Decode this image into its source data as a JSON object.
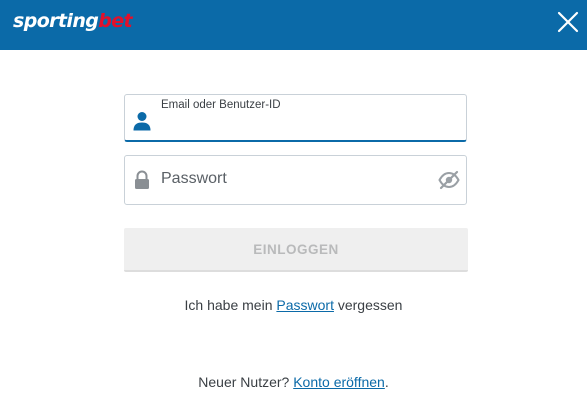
{
  "brand": {
    "logo_part_a": "sporting",
    "logo_part_b": "bet",
    "header_color": "#0b6aa8",
    "accent_red": "#e3102b"
  },
  "header": {
    "close_icon": "close-icon"
  },
  "login_form": {
    "email_label": "Email oder Benutzer-ID",
    "email_value": "",
    "email_icon": "user-icon",
    "password_placeholder": "Passwort",
    "password_value": "",
    "password_icon": "lock-icon",
    "visibility_icon": "eye-slash-icon",
    "login_button_label": "EINLOGGEN",
    "login_button_state": "disabled"
  },
  "forgot": {
    "prefix": "Ich habe mein ",
    "link_label": "Passwort",
    "suffix": " vergessen"
  },
  "register": {
    "prefix": "Neuer Nutzer? ",
    "link_label": "Konto eröffnen",
    "suffix": "."
  }
}
